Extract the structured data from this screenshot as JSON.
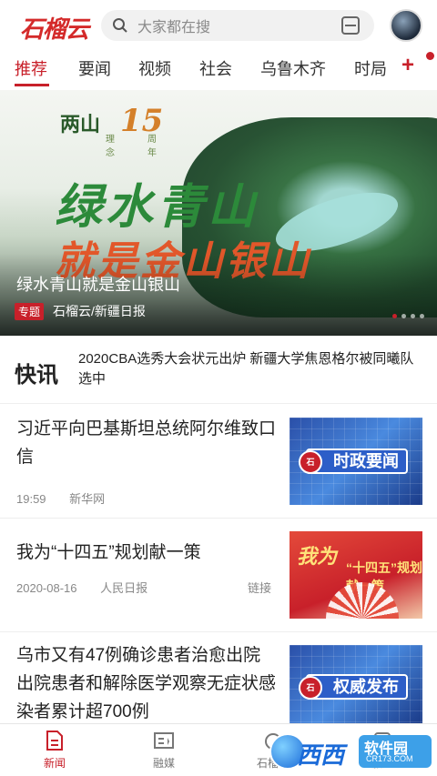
{
  "header": {
    "logo_text": "石榴云",
    "search_placeholder": "大家都在搜"
  },
  "tabs": [
    {
      "label": "推荐",
      "active": true
    },
    {
      "label": "要闻"
    },
    {
      "label": "视频"
    },
    {
      "label": "社会"
    },
    {
      "label": "乌鲁木齐"
    },
    {
      "label": "时局"
    }
  ],
  "tabs_add": "+",
  "banner": {
    "badge_main": "两山",
    "badge_sub": "理念",
    "badge_num": "15",
    "badge_unit": "周年",
    "headline_1": "绿水青山",
    "headline_2": "就是金山银山",
    "title": "绿水青山就是金山银山",
    "tag": "专题",
    "source": "石榴云/新疆日报"
  },
  "flash": {
    "label": "快讯",
    "text": "2020CBA选秀大会状元出炉 新疆大学焦恩格尔被同曦队选中"
  },
  "news": [
    {
      "title": "习近平向巴基斯坦总统阿尔维致口信",
      "time": "19:59",
      "source": "新华网",
      "thumb_label": "时政要闻"
    },
    {
      "title": "我为“十四五”规划献一策",
      "time": "2020-08-16",
      "source": "人民日报",
      "link": "链接",
      "thumb_text_1": "我为",
      "thumb_text_2": "“十四五”规划献一策"
    },
    {
      "title": "乌市又有47例确诊患者治愈出院 出院患者和解除医学观察无症状感染者累计超700例",
      "thumb_label": "权威发布"
    }
  ],
  "bottom_nav": [
    {
      "label": "新闻",
      "active": true
    },
    {
      "label": "融媒"
    },
    {
      "label": "石榴号"
    },
    {
      "label": "服务"
    }
  ],
  "watermark": {
    "brand": "西西",
    "site_name": "软件园",
    "site_url": "CR173.COM"
  },
  "colors": {
    "accent": "#c8202a"
  }
}
